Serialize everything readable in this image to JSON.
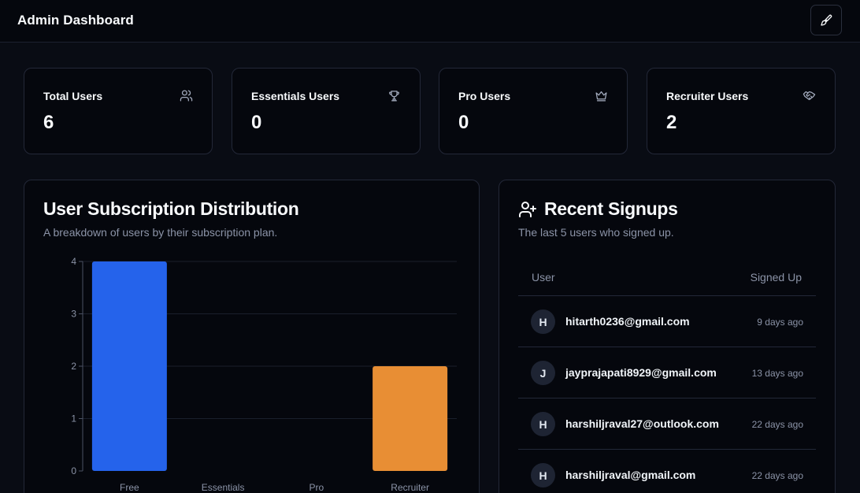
{
  "header": {
    "title": "Admin Dashboard",
    "theme_icon": "paintbrush-icon"
  },
  "stats": [
    {
      "label": "Total Users",
      "value": "6",
      "icon": "users-icon"
    },
    {
      "label": "Essentials Users",
      "value": "0",
      "icon": "trophy-icon"
    },
    {
      "label": "Pro Users",
      "value": "0",
      "icon": "crown-icon"
    },
    {
      "label": "Recruiter Users",
      "value": "2",
      "icon": "handshake-icon"
    }
  ],
  "distribution": {
    "title": "User Subscription Distribution",
    "subtitle": "A breakdown of users by their subscription plan."
  },
  "chart_data": {
    "type": "bar",
    "categories": [
      "Free",
      "Essentials",
      "Pro",
      "Recruiter"
    ],
    "values": [
      4,
      0,
      0,
      2
    ],
    "colors": [
      "#2563eb",
      "#2563eb",
      "#2563eb",
      "#e88e34"
    ],
    "ylim": [
      0,
      4
    ],
    "yticks": [
      0,
      1,
      2,
      3,
      4
    ],
    "xlabel": "",
    "ylabel": "",
    "grid": true
  },
  "signups": {
    "title": "Recent Signups",
    "subtitle": "The last 5 users who signed up.",
    "columns": {
      "user": "User",
      "signed_up": "Signed Up"
    },
    "rows": [
      {
        "initial": "H",
        "email": "hitarth0236@gmail.com",
        "ago": "9 days ago"
      },
      {
        "initial": "J",
        "email": "jayprajapati8929@gmail.com",
        "ago": "13 days ago"
      },
      {
        "initial": "H",
        "email": "harshiljraval27@outlook.com",
        "ago": "22 days ago"
      },
      {
        "initial": "H",
        "email": "harshiljraval@gmail.com",
        "ago": "22 days ago"
      }
    ]
  }
}
